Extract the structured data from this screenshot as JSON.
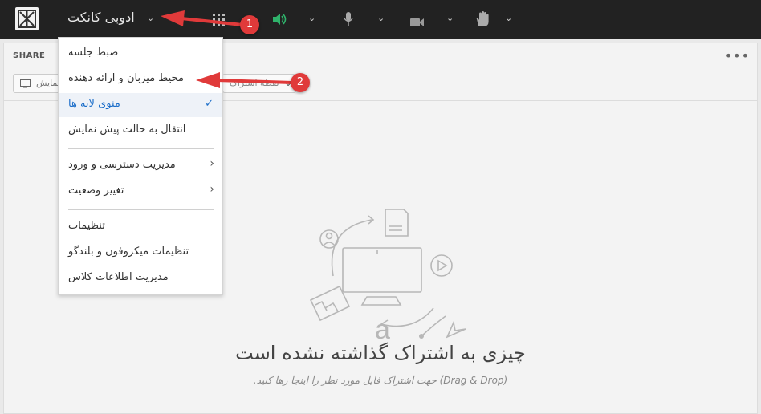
{
  "topbar": {
    "app_name": "ادوبی کانکت",
    "icons": [
      "grid-icon",
      "speaker-icon",
      "microphone-icon",
      "camera-icon",
      "raise-hand-icon"
    ]
  },
  "share_pod": {
    "title": "SHARE",
    "share_button_label": "نمایش",
    "share_button2_label": "نقطه اشتراک",
    "empty_title": "چیزی به اشتراک گذاشته نشده است",
    "empty_subtitle": "(Drag & Drop) جهت اشتراک فایل مورد نظر را اینجا رها کنید."
  },
  "menu": {
    "items": [
      {
        "label": "ضبط جلسه"
      },
      {
        "label": "محیط میزبان و ارائه دهنده"
      },
      {
        "label": "منوی لایه ها",
        "selected": true
      },
      {
        "label": "انتقال به حالت پیش نمایش"
      },
      {
        "label": "مدیریت دسترسی و ورود",
        "submenu": true
      },
      {
        "label": "تغییر وضعیت",
        "submenu": true
      },
      {
        "label": "تنظیمات"
      },
      {
        "label": "تنظیمات میکروفون و بلندگو"
      },
      {
        "label": "مدیریت اطلاعات کلاس"
      }
    ]
  },
  "annotations": {
    "badge1": "1",
    "badge2": "2"
  },
  "colors": {
    "topbar": "#222222",
    "accent": "#1c6ec9",
    "speaker": "#2fb36b",
    "annotation": "#e03a3a"
  }
}
